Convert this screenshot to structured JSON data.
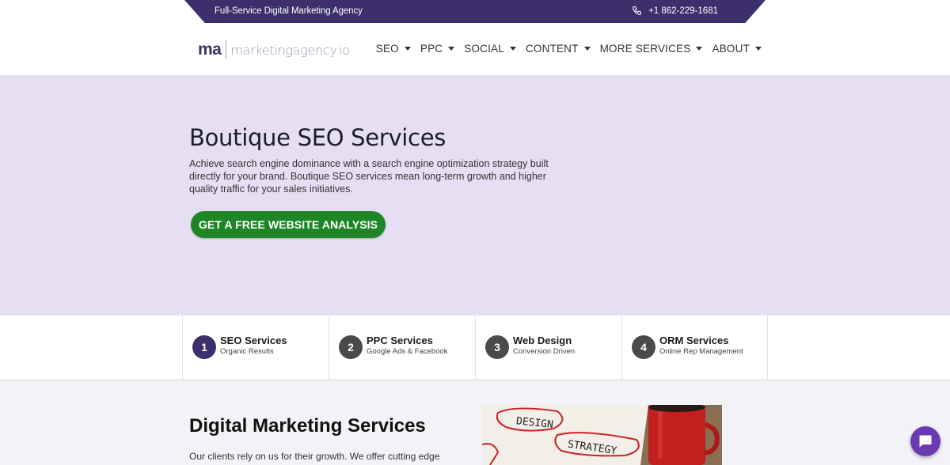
{
  "topbar": {
    "tagline": "Full-Service Digital Marketing Agency",
    "phone": "+1 862-229-1681",
    "phone_icon": "phone-icon"
  },
  "header": {
    "logo_mark": "ma",
    "logo_word": "marketingagency.io",
    "nav": [
      {
        "label": "SEO"
      },
      {
        "label": "PPC"
      },
      {
        "label": "SOCIAL"
      },
      {
        "label": "CONTENT"
      },
      {
        "label": "MORE SERVICES"
      },
      {
        "label": "ABOUT"
      }
    ]
  },
  "hero": {
    "title": "Boutique SEO Services",
    "description": "Achieve search engine dominance with a search engine optimization strategy built directly for your brand. Boutique SEO services mean long-term growth and higher quality traffic for your sales initiatives.",
    "cta_label": "GET A FREE WEBSITE ANALYSIS"
  },
  "steps": [
    {
      "num": "1",
      "title": "SEO Services",
      "sub": "Organic Results"
    },
    {
      "num": "2",
      "title": "PPC Services",
      "sub": "Google Ads & Facebook"
    },
    {
      "num": "3",
      "title": "Web Design",
      "sub": "Conversion Driven"
    },
    {
      "num": "4",
      "title": "ORM Services",
      "sub": "Online Rep Management"
    }
  ],
  "lower": {
    "title": "Digital Marketing Services",
    "intro": "Our clients rely on us for their growth. We offer cutting edge",
    "photo_words": [
      "DESIGN",
      "STRATEGY"
    ]
  },
  "colors": {
    "brand_purple": "#3c2f6b",
    "hero_bg": "#e6def2",
    "cta_green": "#1e8627",
    "chat_purple": "#6b3ab3"
  }
}
